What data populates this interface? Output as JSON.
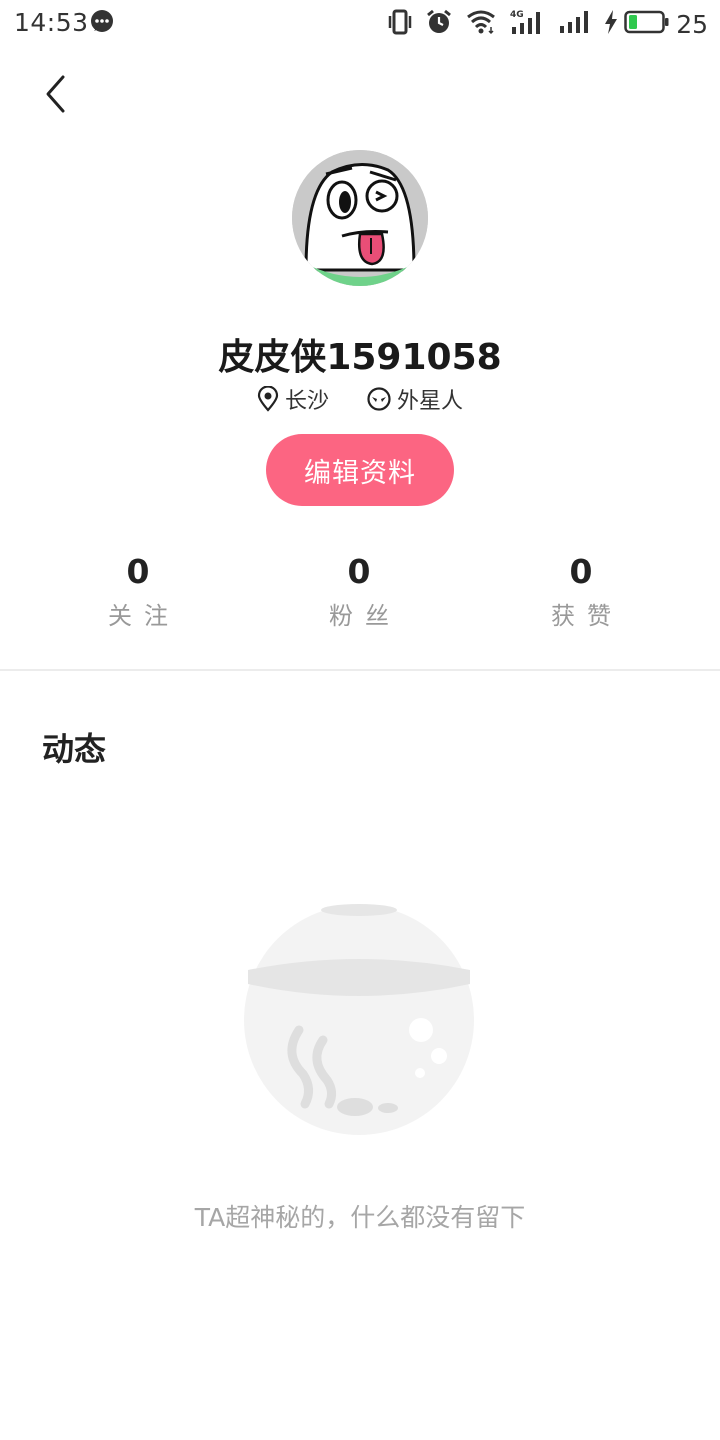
{
  "status_bar": {
    "time": "14:53",
    "network_label": "4G",
    "battery_percent": "25",
    "battery_level": 0.25,
    "icons": [
      "message-icon",
      "vibrate-icon",
      "alarm-icon",
      "wifi-icon",
      "signal-4g-icon",
      "signal-icon",
      "charging-icon",
      "battery-icon"
    ]
  },
  "header": {
    "back_icon": "chevron-left-icon"
  },
  "profile": {
    "username": "皮皮侠1591058",
    "location": "长沙",
    "identity": "外星人",
    "edit_button": "编辑资料"
  },
  "stats": [
    {
      "value": "0",
      "label": "关注"
    },
    {
      "value": "0",
      "label": "粉丝"
    },
    {
      "value": "0",
      "label": "获赞"
    }
  ],
  "feed": {
    "title": "动态",
    "empty_text": "TA超神秘的，什么都没有留下"
  },
  "colors": {
    "accent": "#fc6582",
    "avatar_bg": "#c9c9c9",
    "avatar_accent": "#6fd28a",
    "muted_text": "#999999",
    "battery_green": "#2fc84e"
  }
}
